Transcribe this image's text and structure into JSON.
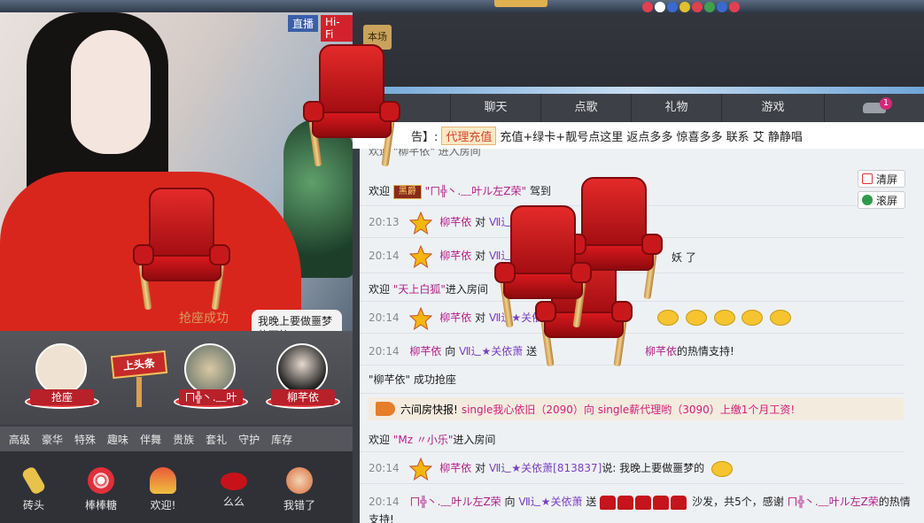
{
  "video": {
    "badge_live": "直播",
    "badge_hifi": "Hi-Fi",
    "grab_text": "抢座成功",
    "bubble_text": "我晚上要做噩梦的狂笑"
  },
  "seats": {
    "grab_label": "抢座",
    "headline_label": "上头条",
    "seat2_label": "ㄇ╬丶.﹏叶",
    "seat3_label": "柳芊依"
  },
  "gift_tabs": [
    "高级",
    "豪华",
    "特殊",
    "趣味",
    "伴舞",
    "贵族",
    "套礼",
    "守护",
    "库存"
  ],
  "gifts": [
    "砖头",
    "棒棒糖",
    "欢迎!",
    "么么",
    "我错了"
  ],
  "hanging_tag": "本场",
  "tabs": {
    "chat": "聊天",
    "song": "点歌",
    "gift": "礼物",
    "game": "游戏",
    "car_badge": "1"
  },
  "announce": {
    "prefix": "告】:",
    "agent": "代理充值",
    "text": "充值+绿卡+靓号点这里 返点多多 惊喜多多 联系 艾 静静唱"
  },
  "side_buttons": {
    "clear": "清屏",
    "scroll": "滚屏"
  },
  "chat": {
    "line0": "欢迎 \"柳芊依\" 进入房间",
    "line1_pre": "欢迎",
    "line1_name": "\"ㄇ╬丶.﹏叶ル左Z荣\"",
    "line1_post": "驾到",
    "line2_time": "20:13",
    "line2_name": "柳芊依",
    "line2_mid": "对",
    "line2_target": "Ⅶ辶★",
    "line3_time": "20:14",
    "line3_name": "柳芊依",
    "line3_mid": "对",
    "line3_target": "Ⅶ辶",
    "line3_tail": "妖 了",
    "line4_pre": "欢迎",
    "line4_name": "\"天上白狐\"",
    "line4_post": "进入房间",
    "line5_time": "20:14",
    "line5_name": "柳芊依",
    "line5_mid": "对",
    "line5_target": "Ⅶ辶★关依萧",
    "line6_time": "20:14",
    "line6_name": "柳芊依",
    "line6_mid": "向",
    "line6_target": "Ⅶ辶★关依萧",
    "line6_send": "送",
    "line6_thanks_name": "柳芊依",
    "line6_tail": "的热情支持!",
    "line7": "\"柳芊依\" 成功抢座",
    "express_prefix": "六间房快报!",
    "express_text": "single我心依旧（2090）向 single薪代理哟（3090）上缴1个月工资!",
    "line9_pre": "欢迎",
    "line9_name": "\"Mz 〃小乐\"",
    "line9_post": "进入房间",
    "line10_time": "20:14",
    "line10_name": "柳芊依",
    "line10_mid": "对",
    "line10_target": "Ⅶ辶★关依萧[813837]",
    "line10_said": "说: 我晚上要做噩梦的",
    "line11_time": "20:14",
    "line11_name": "ㄇ╬丶.﹏叶ル左Z荣",
    "line11_mid": "向",
    "line11_target": "Ⅶ辶★关依萧",
    "line11_send": "送",
    "line11_tail": "沙发，共5个，感谢",
    "line11_thanks_name": "ㄇ╬丶.﹏叶ル左Z荣",
    "line11_end": "的热情",
    "line11_wrap": "支持!"
  },
  "colors": {
    "accent_red": "#d2222c",
    "chat_bg": "#eef1f4",
    "name_color": "#b0218a",
    "target_color": "#7a3fbf"
  }
}
